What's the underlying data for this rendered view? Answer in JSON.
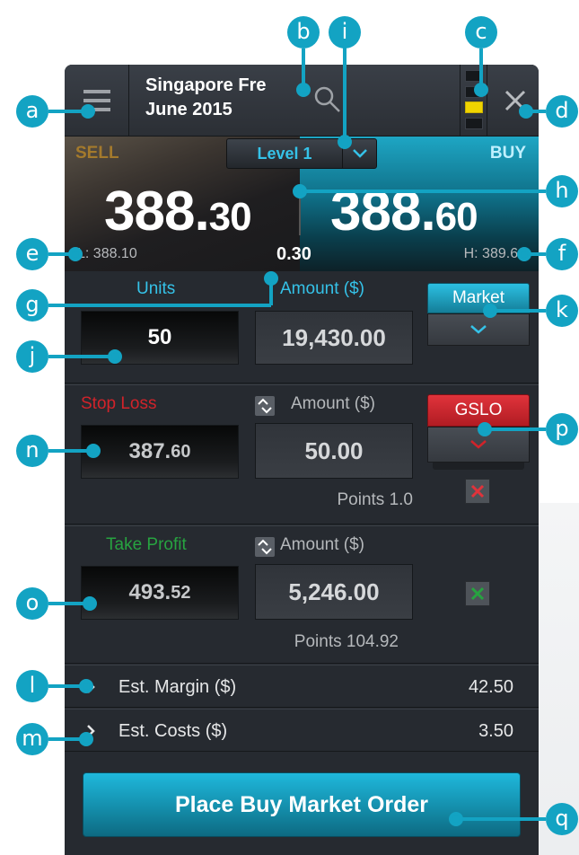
{
  "header": {
    "market_line1": "Singapore Fre",
    "market_line2": "June 2015"
  },
  "price_panel": {
    "sell_label": "SELL",
    "buy_label": "BUY",
    "level_label": "Level 1",
    "sell_price_big": "388.",
    "sell_price_small": "30",
    "buy_price_big": "388.",
    "buy_price_small": "60",
    "low": "L: 388.10",
    "high": "H: 389.60",
    "spread": "0.30"
  },
  "order": {
    "units_label": "Units",
    "amount_label": "Amount ($)",
    "units_value": "50",
    "amount_value": "19,430.00",
    "order_type_label": "Market"
  },
  "stop_loss": {
    "label": "Stop Loss",
    "amount_label": "Amount ($)",
    "price_big": "387.",
    "price_small": "60",
    "amount_value": "50.00",
    "points": "Points 1.0",
    "type_label": "GSLO"
  },
  "take_profit": {
    "label": "Take Profit",
    "amount_label": "Amount ($)",
    "price_big": "493.",
    "price_small": "52",
    "amount_value": "5,246.00",
    "points": "Points 104.92"
  },
  "estimates": {
    "margin_label": "Est. Margin ($)",
    "margin_value": "42.50",
    "costs_label": "Est. Costs ($)",
    "costs_value": "3.50"
  },
  "place_order_label": "Place Buy Market Order",
  "callouts": [
    "a",
    "b",
    "c",
    "d",
    "e",
    "f",
    "g",
    "h",
    "i",
    "j",
    "k",
    "l",
    "m",
    "n",
    "o",
    "p",
    "q"
  ],
  "colors": {
    "accent": "#13a3c3",
    "sell": "#a47a2c",
    "stop_loss": "#d1232a",
    "take_profit": "#27a340",
    "meter_on": "#f0d400"
  }
}
